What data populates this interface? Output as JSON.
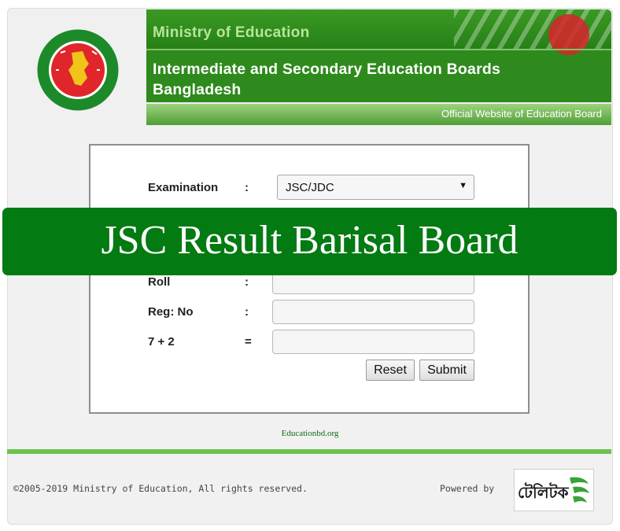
{
  "header": {
    "ministry": "Ministry of Education",
    "boards_line1": "Intermediate and Secondary Education Boards",
    "boards_line2": "Bangladesh",
    "tagline": "Official Website of Education Board"
  },
  "form": {
    "examination": {
      "label": "Examination",
      "sep": ":",
      "selected": "JSC/JDC"
    },
    "roll": {
      "label": "Roll",
      "sep": ":",
      "value": ""
    },
    "reg": {
      "label": "Reg: No",
      "sep": ":",
      "value": ""
    },
    "captcha": {
      "label": "7 + 2",
      "sep": "=",
      "value": ""
    },
    "reset_label": "Reset",
    "submit_label": "Submit"
  },
  "overlay_title": "JSC Result Barisal Board",
  "watermark": "Educationbd.org",
  "footer": {
    "copyright": "©2005-2019 Ministry of Education, All rights reserved.",
    "powered_by": "Powered by",
    "partner_logo_text": "টেলিটক"
  },
  "colors": {
    "brand_green": "#2e8a1c",
    "overlay_green": "#037a12",
    "flag_red": "#d8232a"
  },
  "icons": {
    "seal": "government-seal-icon",
    "dropdown": "chevron-down-icon",
    "partner": "teletalk-logo-icon"
  }
}
